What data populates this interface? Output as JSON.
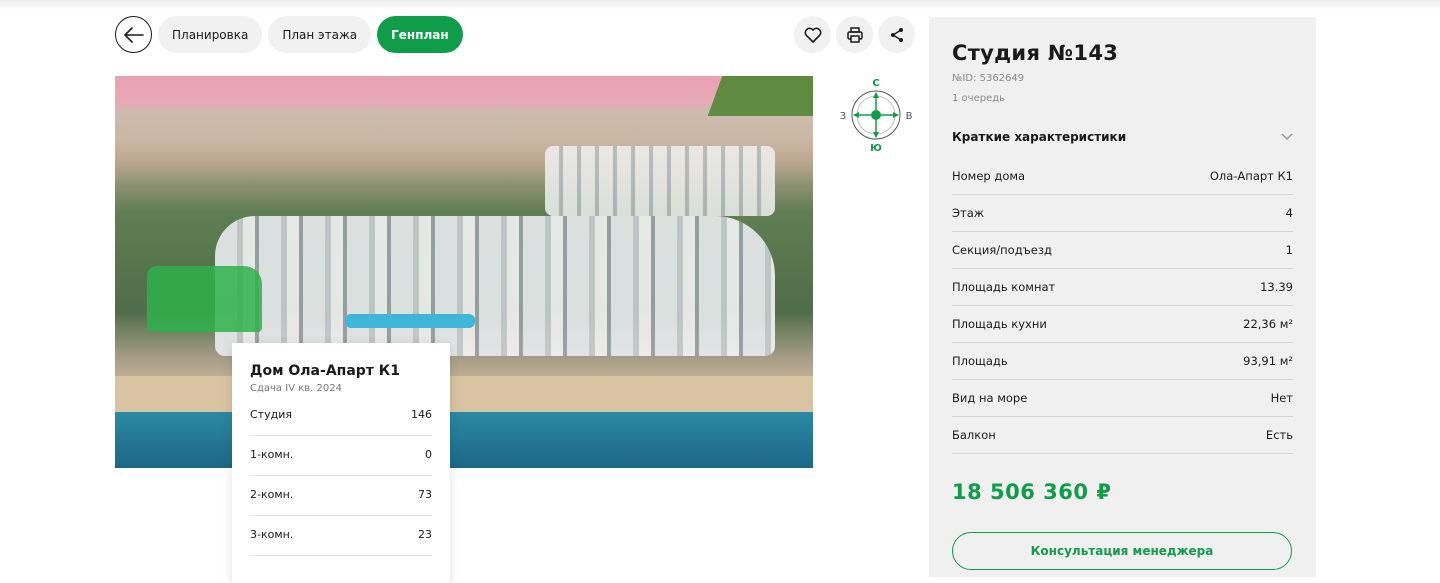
{
  "tabs": [
    {
      "label": "Планировка",
      "active": false
    },
    {
      "label": "План этажа",
      "active": false
    },
    {
      "label": "Генплан",
      "active": true
    }
  ],
  "icons": {
    "back": "arrow-left-icon",
    "favorite": "heart-icon",
    "print": "printer-icon",
    "share": "share-icon"
  },
  "compass": {
    "north": "С",
    "south": "Ю",
    "west": "З",
    "east": "В"
  },
  "house_card": {
    "title": "Дом Ола-Апарт К1",
    "subtitle": "Сдача IV кв. 2024",
    "rows": [
      {
        "label": "Студия",
        "value": "146"
      },
      {
        "label": "1-комн.",
        "value": "0"
      },
      {
        "label": "2-комн.",
        "value": "73"
      },
      {
        "label": "3-комн.",
        "value": "23"
      }
    ]
  },
  "panel": {
    "title": "Студия №143",
    "id_text": "№ID: 5362649",
    "queue": "1 очередь",
    "section_title": "Краткие характеристики",
    "characteristics": [
      {
        "label": "Номер дома",
        "value": "Ола-Апарт К1"
      },
      {
        "label": "Этаж",
        "value": "4"
      },
      {
        "label": "Секция/подъезд",
        "value": "1"
      },
      {
        "label": "Площадь комнат",
        "value": "13.39"
      },
      {
        "label": "Площадь кухни",
        "value": "22,36 м²"
      },
      {
        "label": "Площадь",
        "value": "93,91 м²"
      },
      {
        "label": "Вид на море",
        "value": "Нет"
      },
      {
        "label": "Балкон",
        "value": "Есть"
      }
    ],
    "price": "18 506 360 ₽",
    "consult_label": "Консультация менеджера"
  },
  "colors": {
    "accent": "#0f9d49",
    "panel_bg": "#f0f0f0"
  }
}
